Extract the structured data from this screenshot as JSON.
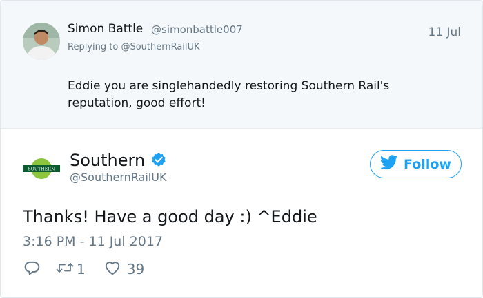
{
  "parent_tweet": {
    "author_name": "Simon Battle",
    "author_handle": "@simonbattle007",
    "date": "11 Jul",
    "replying_prefix": "Replying to",
    "replying_to": "@SouthernRailUK",
    "text": "Eddie you are singlehandedly restoring Southern Rail's reputation, good effort!"
  },
  "main_tweet": {
    "author_name": "Southern",
    "author_handle": "@SouthernRailUK",
    "logo_text": "SOUTHERN",
    "follow_label": "Follow",
    "text": "Thanks! Have a good day :) ^Eddie",
    "timestamp": "3:16 PM - 11 Jul 2017",
    "retweet_count": "1",
    "like_count": "39"
  },
  "colors": {
    "accent": "#1da1f2",
    "muted": "#657786",
    "parent_background": "#f5f8fa",
    "southern_green": "#8cc63f",
    "southern_dark": "#0b5c2e"
  },
  "icons": {
    "verified": "verified-badge-icon",
    "follow": "twitter-bird-icon",
    "reply": "reply-icon",
    "retweet": "retweet-icon",
    "like": "heart-icon"
  }
}
